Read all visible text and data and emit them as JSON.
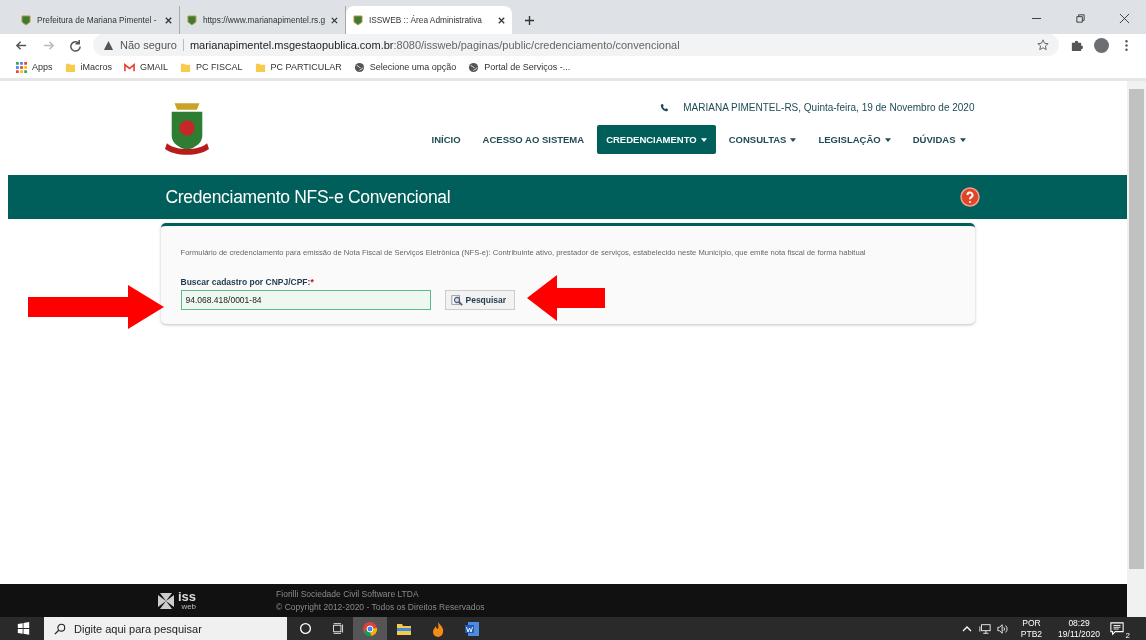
{
  "browser": {
    "tabs": [
      {
        "title": "Prefeitura de Mariana Pimentel -",
        "selected": false
      },
      {
        "title": "https://www.marianapimentel.rs.g",
        "selected": false
      },
      {
        "title": "ISSWEB :: Área Administrativa",
        "selected": true
      }
    ],
    "security": "Não seguro",
    "url_host": "marianapimentel.msgestaopublica.com.br",
    "url_path": ":8080/issweb/paginas/public/credenciamento/convencional",
    "bookmarks": [
      {
        "label": "Apps",
        "kind": "apps"
      },
      {
        "label": "iMacros",
        "kind": "folder"
      },
      {
        "label": "GMAIL",
        "kind": "gmail"
      },
      {
        "label": "PC FISCAL",
        "kind": "folder"
      },
      {
        "label": "PC PARTICULAR",
        "kind": "folder"
      },
      {
        "label": "Selecione uma opção",
        "kind": "globe"
      },
      {
        "label": "Portal de Serviços -...",
        "kind": "globe"
      }
    ]
  },
  "header": {
    "location_date": "MARIANA PIMENTEL-RS, Quinta-feira, 19 de Novembro de 2020",
    "nav": [
      {
        "label": "INÍCIO",
        "selected": false,
        "dropdown": false
      },
      {
        "label": "ACESSO AO SISTEMA",
        "selected": false,
        "dropdown": false
      },
      {
        "label": "CREDENCIAMENTO",
        "selected": true,
        "dropdown": true
      },
      {
        "label": "CONSULTAS",
        "selected": false,
        "dropdown": true
      },
      {
        "label": "LEGISLAÇÃO",
        "selected": false,
        "dropdown": true
      },
      {
        "label": "DÚVIDAS",
        "selected": false,
        "dropdown": true
      }
    ]
  },
  "page_title": "Credenciamento NFS-e Convencional",
  "form": {
    "description": "Formulário de credenciamento para emissão de Nota Fiscal de Serviços Eletrônica (NFS-e): Contribuinte ativo, prestador de serviços, estabelecido neste Município, que emite nota fiscal de forma habitual",
    "field_label": "Buscar cadastro por CNPJ/CPF:",
    "required_mark": "*",
    "value": "94.068.418/0001-84",
    "button": "Pesquisar"
  },
  "footer": {
    "logo_text": "iss",
    "logo_subtext": "web",
    "lines": [
      "Fiorilli Sociedade Civil Software LTDA",
      "© Copyright 2012-2020 - Todos os Direitos Reservados"
    ]
  },
  "taskbar": {
    "search_placeholder": "Digite aqui para pesquisar",
    "language": "POR",
    "layout": "PTB2",
    "time": "08:29",
    "date": "19/11/2020",
    "notifications": "2"
  }
}
